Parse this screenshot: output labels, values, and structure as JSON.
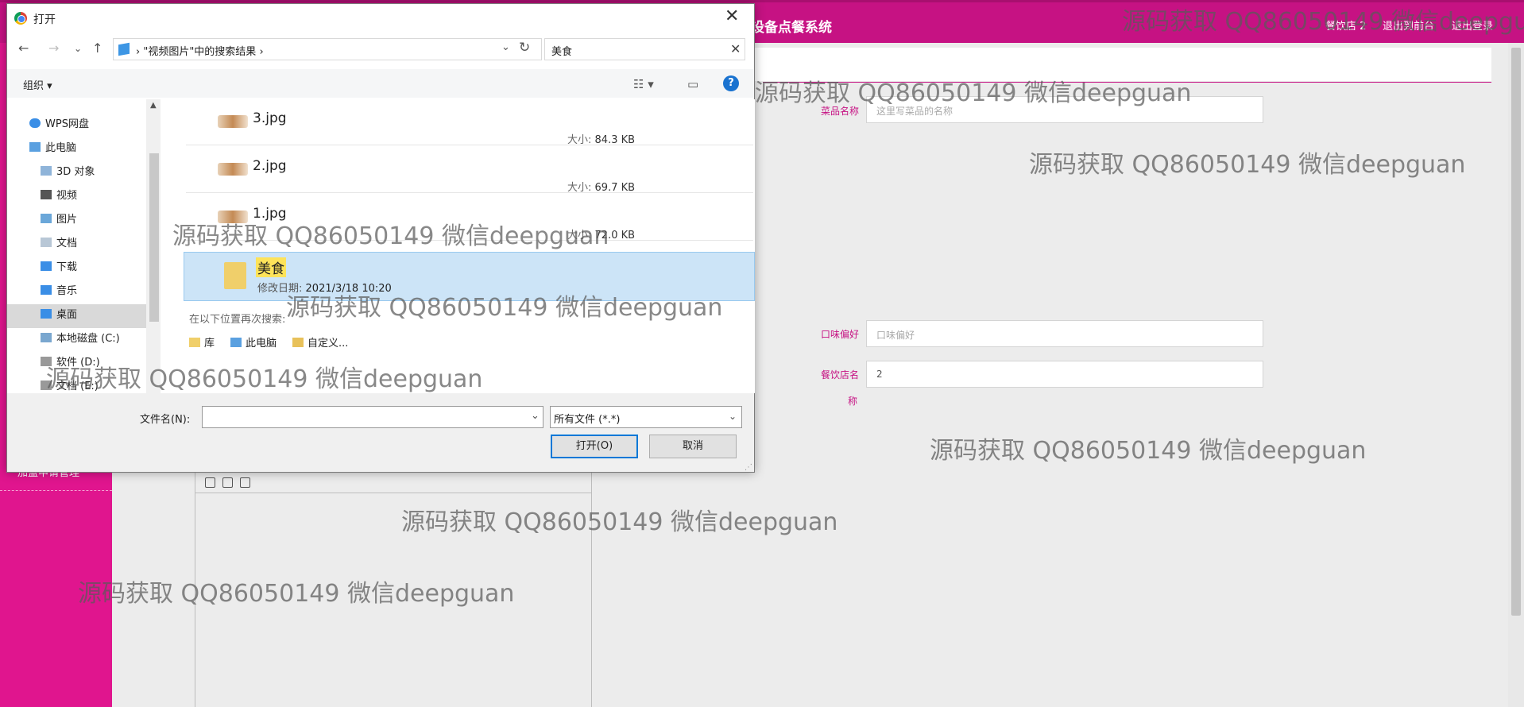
{
  "app": {
    "title": "设备点餐系统",
    "menu": [
      "餐饮店 2",
      "退出到前台",
      "退出登录"
    ],
    "sidebar_item": "加盟申请管理"
  },
  "form": {
    "dish_name_label": "菜品名称",
    "dish_name_placeholder": "这里写菜品的名称",
    "taste_label": "口味偏好",
    "taste_placeholder": "口味偏好",
    "shop_label": "餐饮店名",
    "shop_label_wrap": "称",
    "shop_value": "2"
  },
  "dialog": {
    "title": "打开",
    "close_symbol": "✕",
    "nav": {
      "back": "←",
      "forward": "→",
      "recent": "⌄",
      "up": "↑"
    },
    "address": "\"视频图片\"中的搜索结果",
    "address_sep": "›",
    "search_value": "美食",
    "organize": "组织 ▾",
    "help": "?",
    "tree": [
      "WPS网盘",
      "此电脑",
      "3D 对象",
      "视频",
      "图片",
      "文档",
      "下载",
      "音乐",
      "桌面",
      "本地磁盘 (C:)",
      "软件 (D:)",
      "文档 (E:)"
    ],
    "files": [
      {
        "name": "3.jpg",
        "size_label": "大小:",
        "size": "84.3 KB"
      },
      {
        "name": "2.jpg",
        "size_label": "大小:",
        "size": "69.7 KB"
      },
      {
        "name": "1.jpg",
        "size_label": "大小:",
        "size": "72.0 KB"
      }
    ],
    "folder": {
      "name": "美食",
      "date_label": "修改日期:",
      "date": "2021/3/18 10:20"
    },
    "search_again": "在以下位置再次搜索:",
    "search_locations": [
      "库",
      "此电脑",
      "自定义..."
    ],
    "filename_label": "文件名(N):",
    "filename_value": "",
    "filetype": "所有文件 (*.*)",
    "open_button": "打开(O)",
    "cancel_button": "取消"
  },
  "watermark": "源码获取 QQ86050149 微信deepguan"
}
